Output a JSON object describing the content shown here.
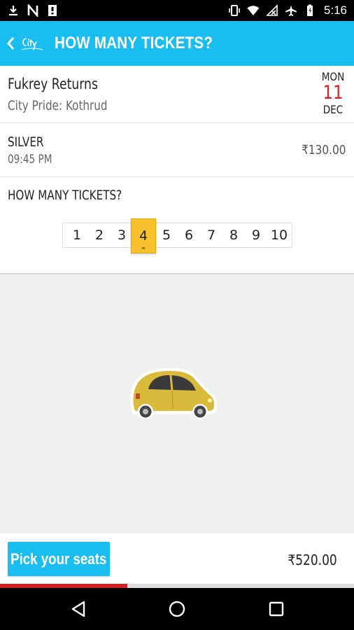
{
  "status_bar": {
    "time": "5:16",
    "left_icons": [
      "download-icon",
      "notification-n-icon",
      "notification-badge-icon"
    ],
    "right_icons": [
      "vibrate-icon",
      "wifi-icon",
      "no-signal-icon",
      "airplane-icon",
      "battery-icon"
    ]
  },
  "app_bar": {
    "title": "HOW MANY TICKETS?",
    "back_icon": "chevron-left-icon",
    "logo_text": "CityPride"
  },
  "movie": {
    "title": "Fukrey Returns",
    "venue": "City Pride: Kothrud",
    "date": {
      "day": "MON",
      "num": "11",
      "month": "DEC"
    }
  },
  "seat_class": {
    "name": "SILVER",
    "time": "09:45 PM",
    "price": "₹130.00"
  },
  "ticket_picker": {
    "label": "HOW MANY TICKETS?",
    "options": [
      "1",
      "2",
      "3",
      "4",
      "5",
      "6",
      "7",
      "8",
      "9",
      "10"
    ],
    "selected": "4"
  },
  "illustration": {
    "icon": "car-icon"
  },
  "footer": {
    "pick_seats_label": "Pick your seats",
    "total": "₹520.00",
    "progress": 0.36
  },
  "colors": {
    "accent": "#19bdef",
    "selected": "#f7c12b",
    "date_red": "#d32027"
  }
}
